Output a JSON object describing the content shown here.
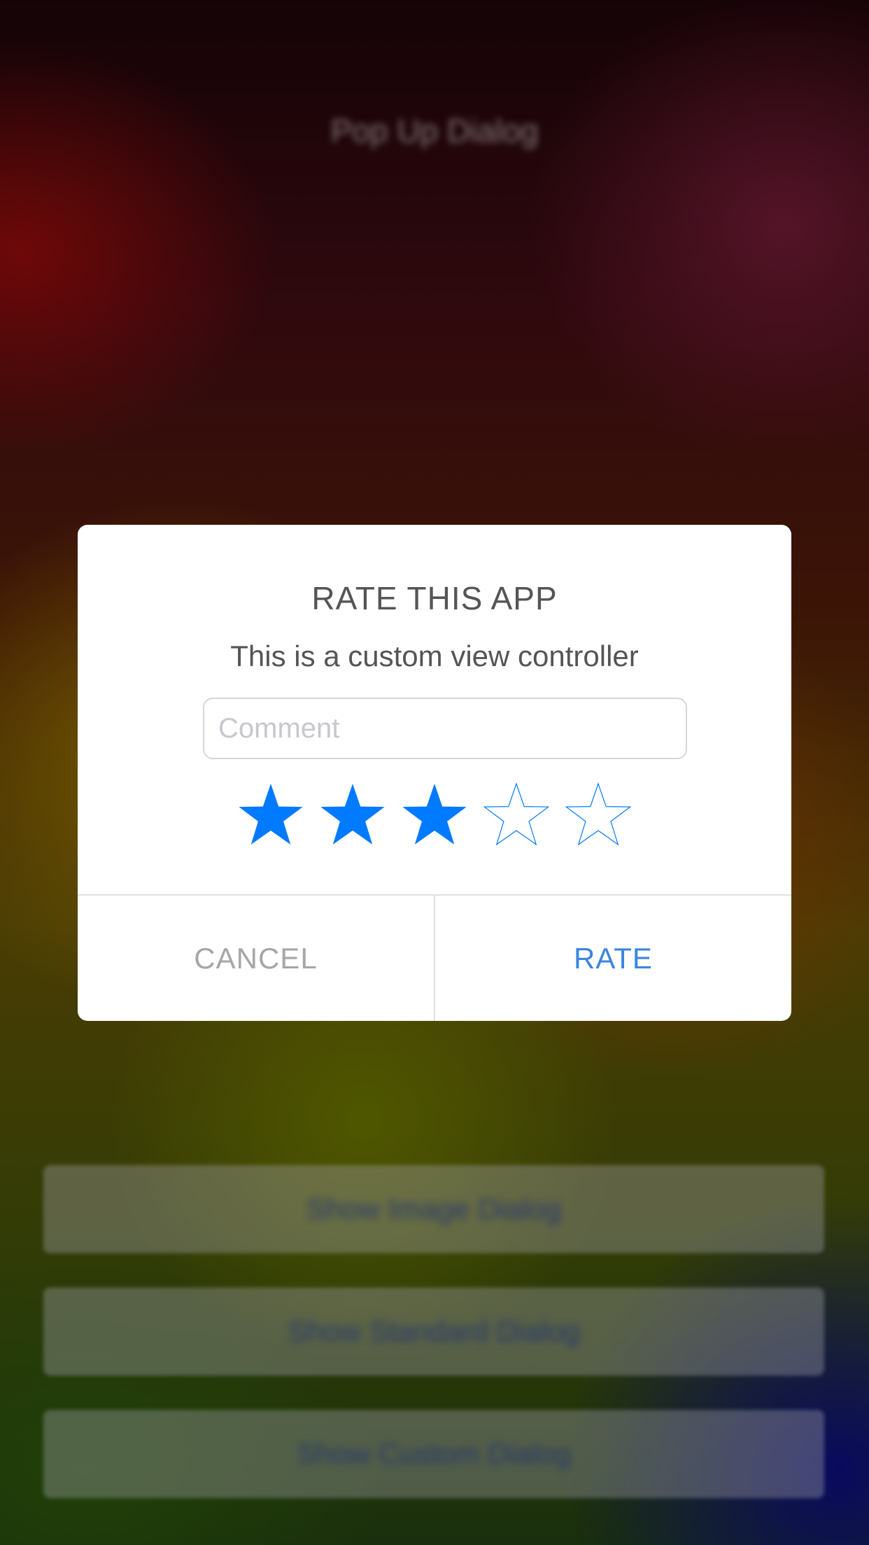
{
  "background": {
    "title": "Pop Up Dialog",
    "buttons": [
      {
        "label": "Show Image Dialog"
      },
      {
        "label": "Show Standard Dialog"
      },
      {
        "label": "Show Custom Dialog"
      }
    ]
  },
  "dialog": {
    "title": "RATE THIS APP",
    "message": "This is a custom view controller",
    "comment": {
      "placeholder": "Comment",
      "value": ""
    },
    "rating": {
      "value": 3,
      "max": 5,
      "accent_color": "#007aff"
    },
    "buttons": {
      "cancel_label": "CANCEL",
      "rate_label": "RATE"
    }
  },
  "colors": {
    "title_text": "#555555",
    "cancel_text": "#a6a6a6",
    "rate_text": "#3b86dd",
    "star": "#007aff"
  },
  "icons": {
    "star_filled": "star-filled-icon",
    "star_empty": "star-outline-icon"
  }
}
